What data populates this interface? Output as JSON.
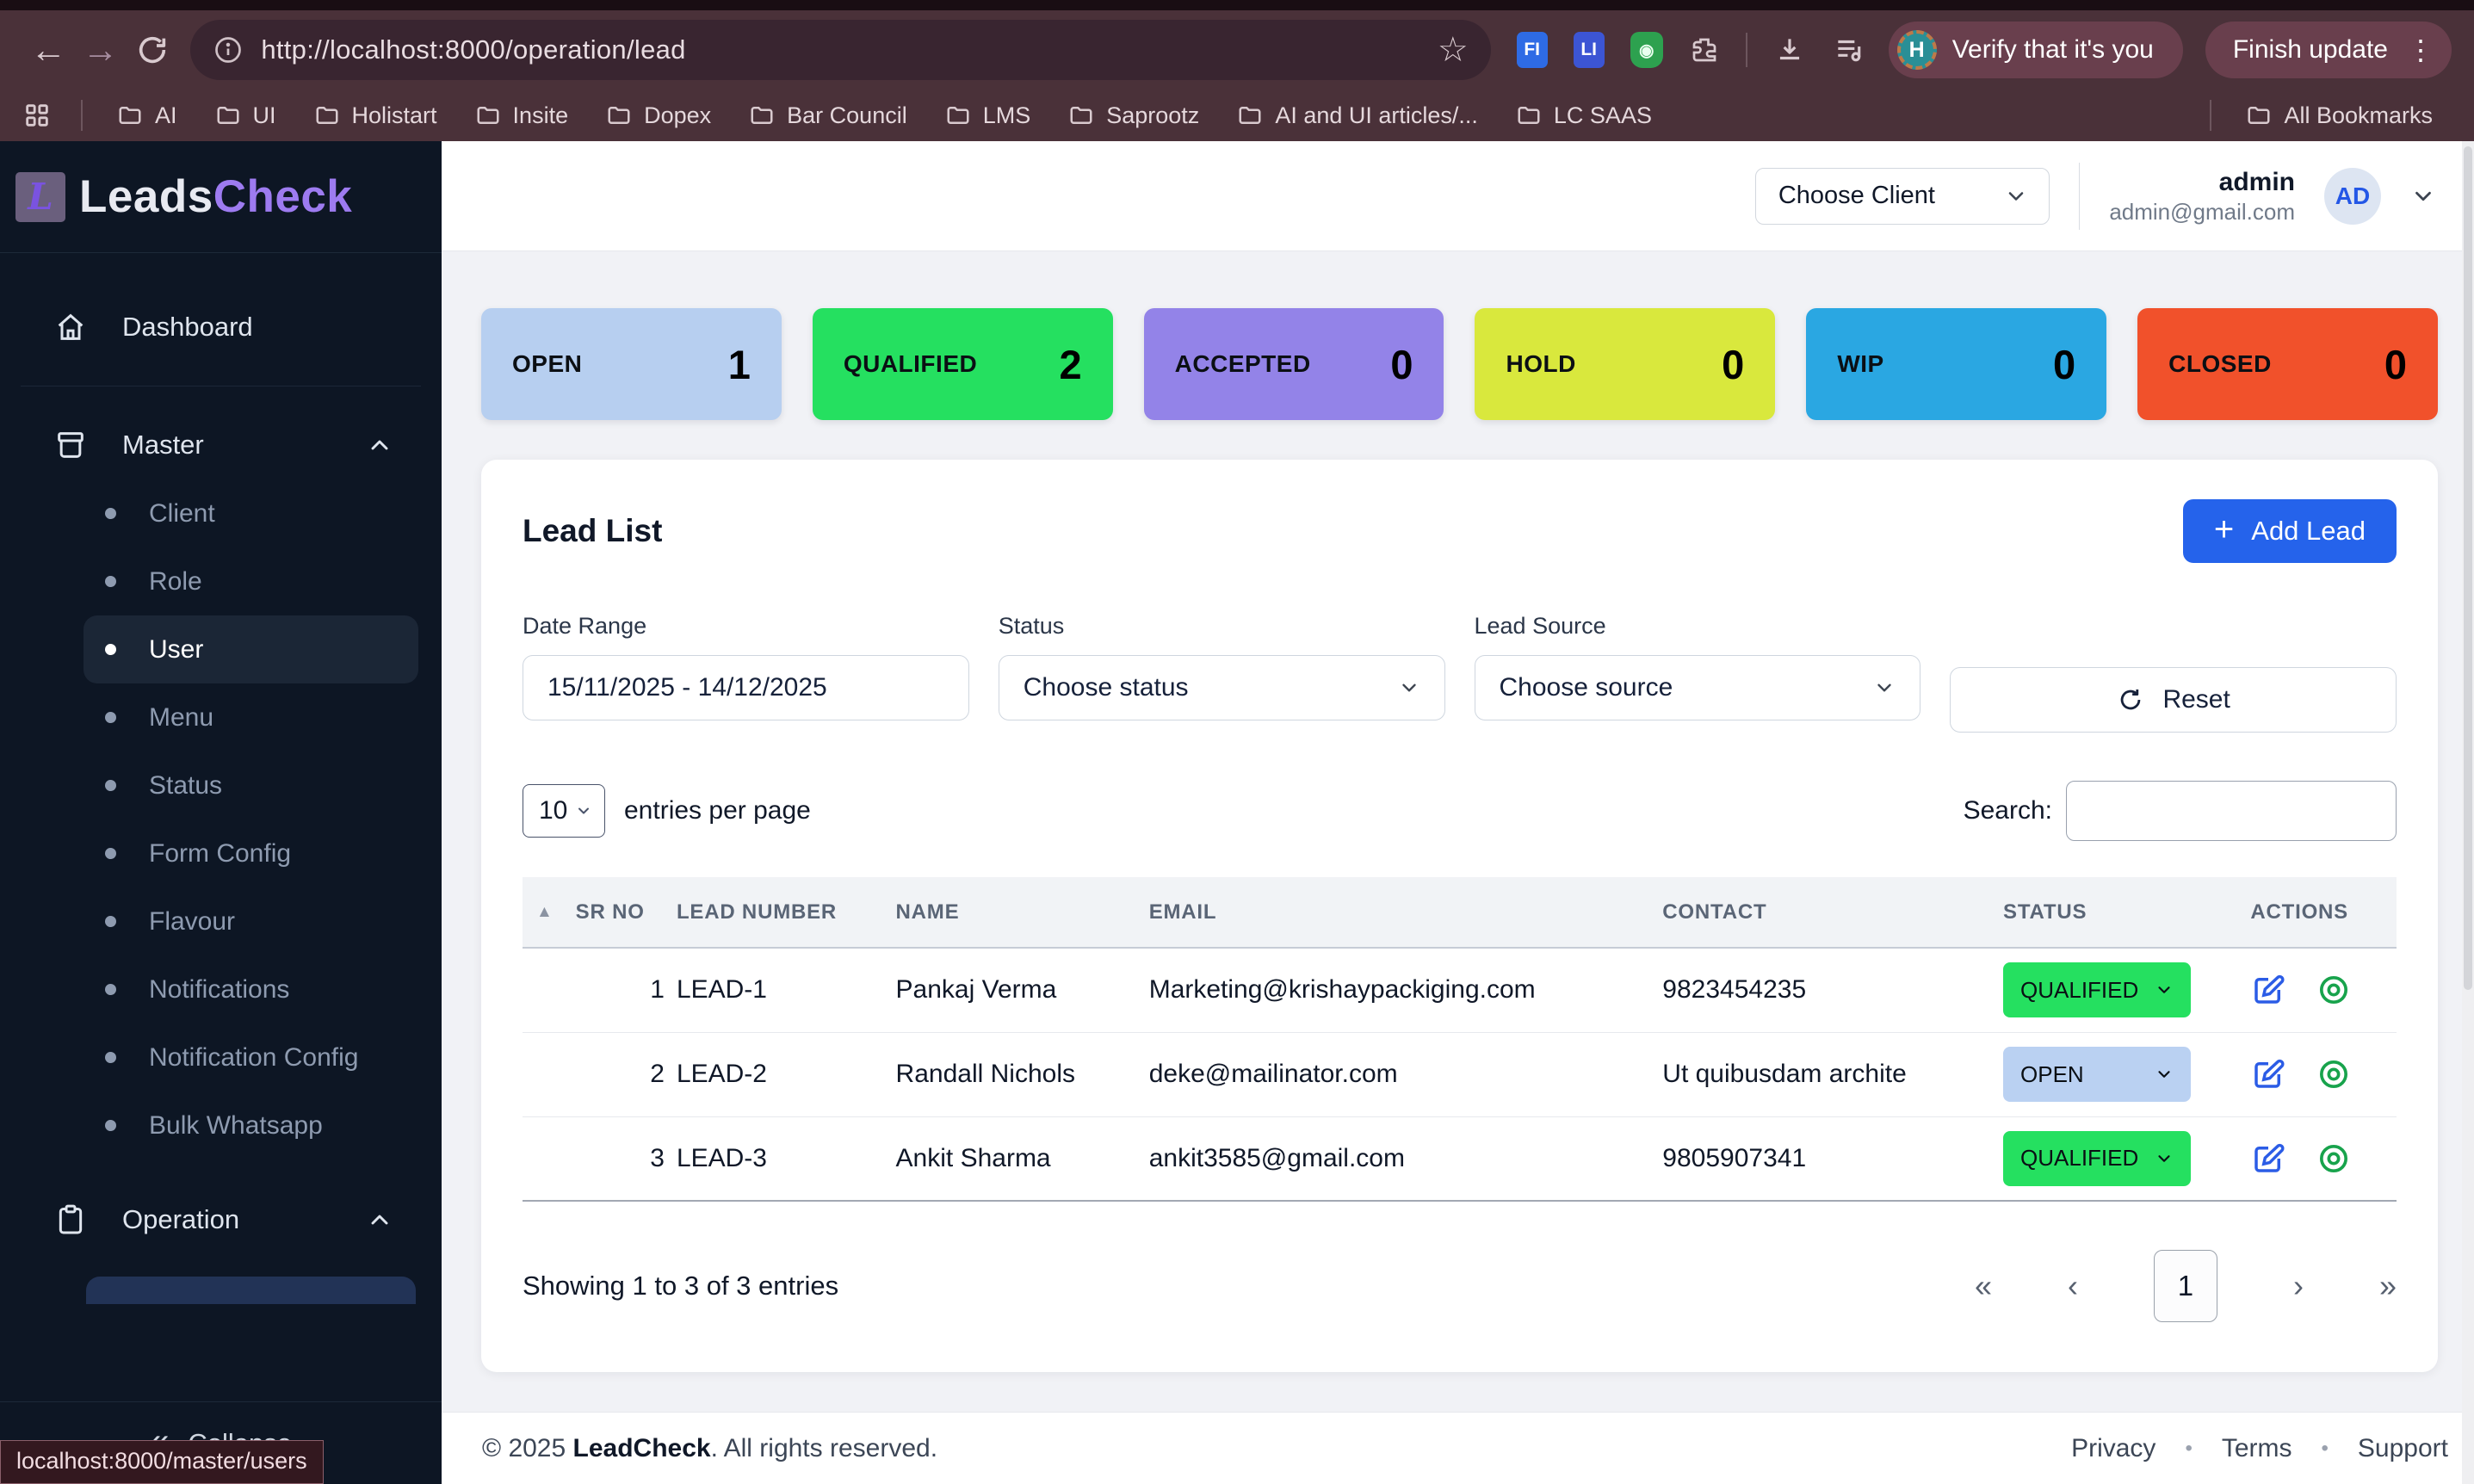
{
  "browser": {
    "url": "http://localhost:8000/operation/lead",
    "ext_fi": "FI",
    "ext_li": "LI",
    "verify_avatar": "H",
    "verify_label": "Verify that it's you",
    "finish_label": "Finish update",
    "kebab": "⋮",
    "bookmarks": [
      "AI",
      "UI",
      "Holistart",
      "Insite",
      "Dopex",
      "Bar Council",
      "LMS",
      "Saprootz",
      "AI and UI articles/...",
      "LC SAAS"
    ],
    "all_bookmarks": "All Bookmarks"
  },
  "sidebar": {
    "logo_mark": "L",
    "logo_leads": "Leads",
    "logo_check": "Check",
    "dashboard": "Dashboard",
    "master_label": "Master",
    "master_items": [
      {
        "label": "Client",
        "active": false
      },
      {
        "label": "Role",
        "active": false
      },
      {
        "label": "User",
        "active": true
      },
      {
        "label": "Menu",
        "active": false
      },
      {
        "label": "Status",
        "active": false
      },
      {
        "label": "Form Config",
        "active": false
      },
      {
        "label": "Flavour",
        "active": false
      },
      {
        "label": "Notifications",
        "active": false
      },
      {
        "label": "Notification Config",
        "active": false
      },
      {
        "label": "Bulk Whatsapp",
        "active": false
      }
    ],
    "operation_label": "Operation",
    "collapse_icon": "«",
    "collapse_label": "Collapse"
  },
  "header": {
    "choose_client": "Choose Client",
    "user_name": "admin",
    "user_email": "admin@gmail.com",
    "avatar": "AD"
  },
  "stats": [
    {
      "label": "OPEN",
      "value": "1",
      "color": "#b7cff0"
    },
    {
      "label": "QUALIFIED",
      "value": "2",
      "color": "#25e060"
    },
    {
      "label": "ACCEPTED",
      "value": "0",
      "color": "#9383e8"
    },
    {
      "label": "HOLD",
      "value": "0",
      "color": "#d9e83d"
    },
    {
      "label": "WIP",
      "value": "0",
      "color": "#2aa7e2"
    },
    {
      "label": "CLOSED",
      "value": "0",
      "color": "#f1512b"
    }
  ],
  "lead_list": {
    "title": "Lead List",
    "add_button": "Add Lead",
    "filters": {
      "date_label": "Date Range",
      "date_value": "15/11/2025 - 14/12/2025",
      "status_label": "Status",
      "status_value": "Choose status",
      "source_label": "Lead Source",
      "source_value": "Choose source",
      "reset_label": "Reset"
    },
    "per_page_value": "10",
    "per_page_label": "entries per page",
    "search_label": "Search:",
    "table": {
      "sort_icon": "▲",
      "headers": [
        "SR NO",
        "LEAD NUMBER",
        "NAME",
        "EMAIL",
        "CONTACT",
        "STATUS",
        "ACTIONS"
      ],
      "rows": [
        {
          "sr": "1",
          "lead": "LEAD-1",
          "name": "Pankaj Verma",
          "email": "Marketing@krishaypackiging.com",
          "contact": "9823454235",
          "status": "QUALIFIED",
          "status_color": "#25e060"
        },
        {
          "sr": "2",
          "lead": "LEAD-2",
          "name": "Randall Nichols",
          "email": "deke@mailinator.com",
          "contact": "Ut quibusdam archite",
          "status": "OPEN",
          "status_color": "#bad1f2"
        },
        {
          "sr": "3",
          "lead": "LEAD-3",
          "name": "Ankit Sharma",
          "email": "ankit3585@gmail.com",
          "contact": "9805907341",
          "status": "QUALIFIED",
          "status_color": "#25e060"
        }
      ]
    },
    "showing": "Showing 1 to 3 of 3 entries",
    "pagination": {
      "first": "«",
      "prev": "‹",
      "page": "1",
      "next": "›",
      "last": "»"
    }
  },
  "footer": {
    "copy_prefix": "© 2025 ",
    "brand": "LeadCheck",
    "copy_suffix": ". All rights reserved.",
    "links": [
      "Privacy",
      "Terms",
      "Support"
    ],
    "dot": "•"
  },
  "statusbar": "localhost:8000/master/users"
}
